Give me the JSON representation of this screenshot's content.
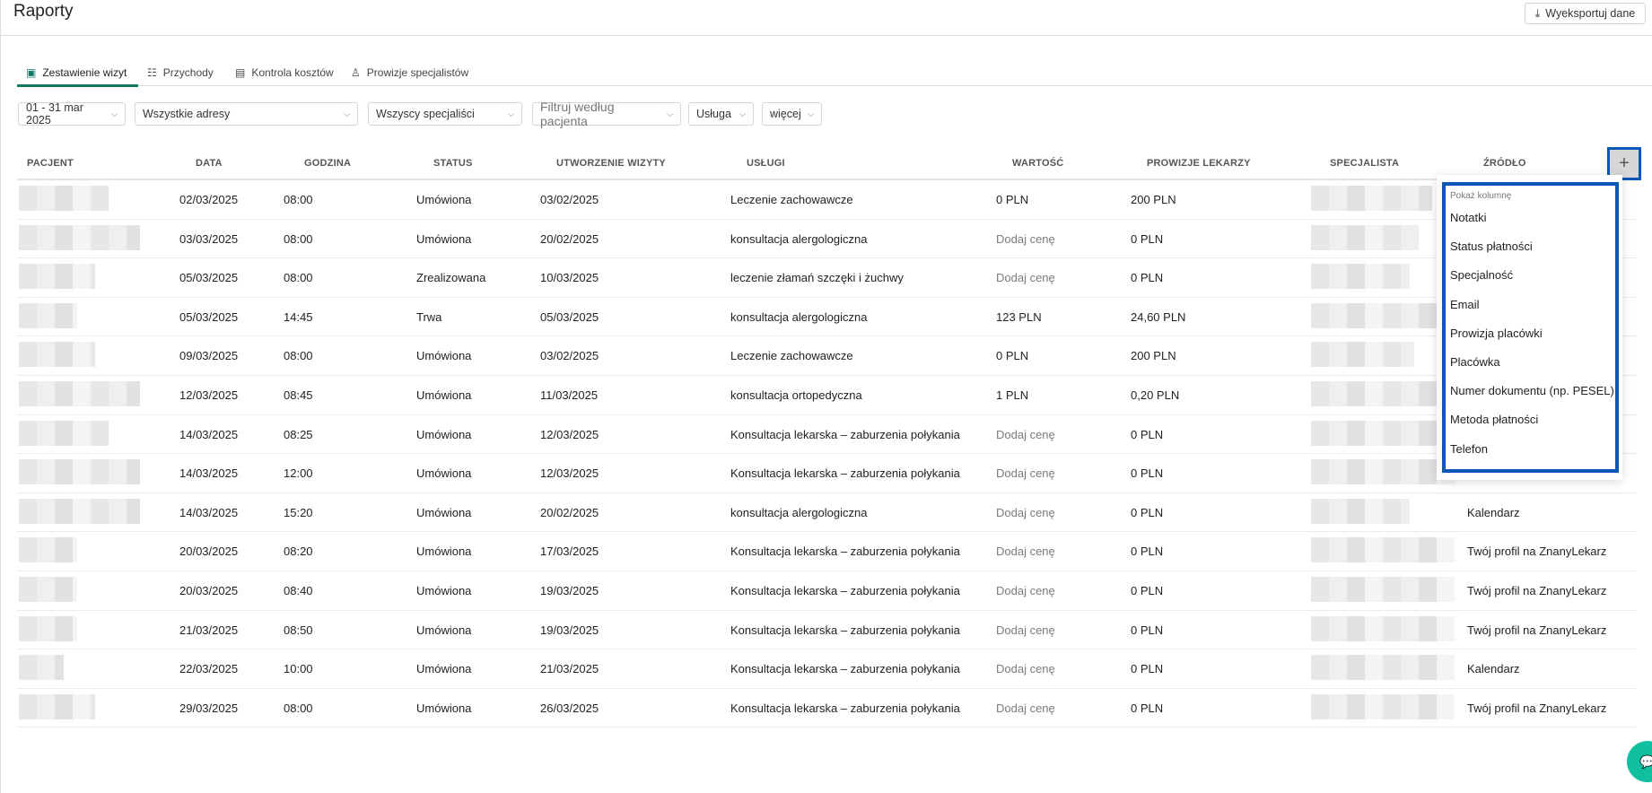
{
  "header": {
    "title": "Raporty",
    "export_label": "Wyeksportuj dane",
    "export_icon": "download-icon"
  },
  "tabs": [
    {
      "label": "Zestawienie wizyt",
      "icon": "calendar-check-icon",
      "active": true
    },
    {
      "label": "Przychody",
      "icon": "list-check-icon"
    },
    {
      "label": "Kontrola kosztów",
      "icon": "wallet-icon"
    },
    {
      "label": "Prowizje specjalistów",
      "icon": "person-icon"
    }
  ],
  "filters": {
    "date": "01 - 31 mar 2025",
    "address": "Wszystkie adresy",
    "specialist": "Wszyscy specjaliści",
    "patient_placeholder": "Filtruj według pacjenta",
    "service": "Usługa",
    "more": "więcej"
  },
  "table": {
    "columns": [
      "PACJENT",
      "DATA",
      "GODZINA",
      "STATUS",
      "UTWORZENIE WIZYTY",
      "USŁUGI",
      "WARTOŚĆ",
      "PROWIZJE LEKARZY",
      "SPECJALISTA",
      "ŹRÓDŁO"
    ],
    "rows": [
      {
        "date": "02/03/2025",
        "time": "08:00",
        "status": "Umówiona",
        "created": "03/02/2025",
        "service": "Leczenie zachowawcze",
        "value": "0 PLN",
        "commission": "200 PLN",
        "source": ""
      },
      {
        "date": "03/03/2025",
        "time": "08:00",
        "status": "Umówiona",
        "created": "20/02/2025",
        "service": "konsultacja alergologiczna",
        "value": "Dodaj cenę",
        "commission": "0 PLN",
        "source": ""
      },
      {
        "date": "05/03/2025",
        "time": "08:00",
        "status": "Zrealizowana",
        "created": "10/03/2025",
        "service": "leczenie złamań szczęki i żuchwy",
        "value": "Dodaj cenę",
        "commission": "0 PLN",
        "source": ""
      },
      {
        "date": "05/03/2025",
        "time": "14:45",
        "status": "Trwa",
        "created": "05/03/2025",
        "service": "konsultacja alergologiczna",
        "value": "123 PLN",
        "commission": "24,60 PLN",
        "source": ""
      },
      {
        "date": "09/03/2025",
        "time": "08:00",
        "status": "Umówiona",
        "created": "03/02/2025",
        "service": "Leczenie zachowawcze",
        "value": "0 PLN",
        "commission": "200 PLN",
        "source": ""
      },
      {
        "date": "12/03/2025",
        "time": "08:45",
        "status": "Umówiona",
        "created": "11/03/2025",
        "service": "konsultacja ortopedyczna",
        "value": "1 PLN",
        "commission": "0,20 PLN",
        "source": ""
      },
      {
        "date": "14/03/2025",
        "time": "08:25",
        "status": "Umówiona",
        "created": "12/03/2025",
        "service": "Konsultacja lekarska – zaburzenia połykania",
        "value": "Dodaj cenę",
        "commission": "0 PLN",
        "source": ""
      },
      {
        "date": "14/03/2025",
        "time": "12:00",
        "status": "Umówiona",
        "created": "12/03/2025",
        "service": "Konsultacja lekarska – zaburzenia połykania",
        "value": "Dodaj cenę",
        "commission": "0 PLN",
        "source": ""
      },
      {
        "date": "14/03/2025",
        "time": "15:20",
        "status": "Umówiona",
        "created": "20/02/2025",
        "service": "konsultacja alergologiczna",
        "value": "Dodaj cenę",
        "commission": "0 PLN",
        "source": "Kalendarz"
      },
      {
        "date": "20/03/2025",
        "time": "08:20",
        "status": "Umówiona",
        "created": "17/03/2025",
        "service": "Konsultacja lekarska – zaburzenia połykania",
        "value": "Dodaj cenę",
        "commission": "0 PLN",
        "source": "Twój profil na ZnanyLekarz"
      },
      {
        "date": "20/03/2025",
        "time": "08:40",
        "status": "Umówiona",
        "created": "19/03/2025",
        "service": "Konsultacja lekarska – zaburzenia połykania",
        "value": "Dodaj cenę",
        "commission": "0 PLN",
        "source": "Twój profil na ZnanyLekarz"
      },
      {
        "date": "21/03/2025",
        "time": "08:50",
        "status": "Umówiona",
        "created": "19/03/2025",
        "service": "Konsultacja lekarska – zaburzenia połykania",
        "value": "Dodaj cenę",
        "commission": "0 PLN",
        "source": "Twój profil na ZnanyLekarz"
      },
      {
        "date": "22/03/2025",
        "time": "10:00",
        "status": "Umówiona",
        "created": "21/03/2025",
        "service": "Konsultacja lekarska – zaburzenia połykania",
        "value": "Dodaj cenę",
        "commission": "0 PLN",
        "source": "Kalendarz"
      },
      {
        "date": "29/03/2025",
        "time": "08:00",
        "status": "Umówiona",
        "created": "26/03/2025",
        "service": "Konsultacja lekarska – zaburzenia połykania",
        "value": "Dodaj cenę",
        "commission": "0 PLN",
        "source": "Twój profil na ZnanyLekarz"
      }
    ]
  },
  "column_menu": {
    "add_label": "+",
    "title": "Pokaż kolumnę",
    "items": [
      "Notatki",
      "Status płatności",
      "Specjalność",
      "Email",
      "Prowizja placówki",
      "Placówka",
      "Numer dokumentu (np. PESEL)",
      "Metoda płatności",
      "Telefon"
    ]
  },
  "colors": {
    "accent": "#0f7a64",
    "highlight": "#0a58b8",
    "chat": "#0fbfa0"
  }
}
